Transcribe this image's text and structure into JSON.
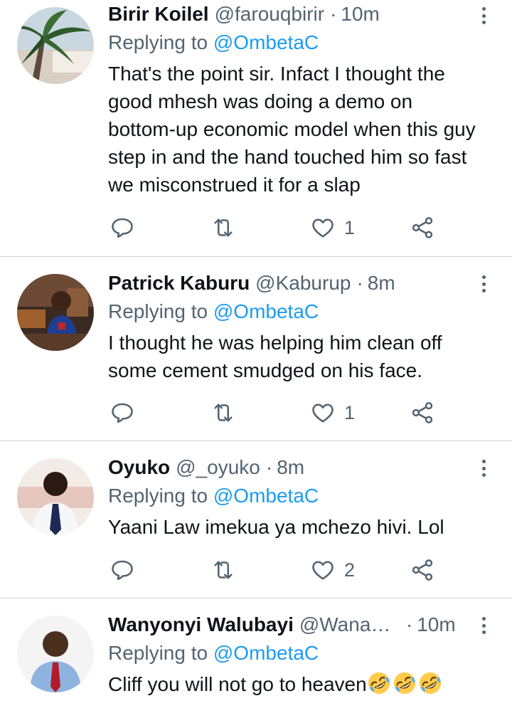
{
  "tweets": [
    {
      "name": "Birir Koilel",
      "handle": "@farouqbirir",
      "separator": "·",
      "time": "10m",
      "replying_prefix": "Replying to",
      "replying_to": "@OmbetaC",
      "text": "That's the point sir. Infact I thought the good mhesh was doing a demo on bottom-up economic model when this guy step in and the hand touched him so fast we misconstrued it for a slap",
      "likes": "1"
    },
    {
      "name": "Patrick Kaburu",
      "handle": "@Kaburup",
      "separator": "·",
      "time": "8m",
      "replying_prefix": "Replying to",
      "replying_to": "@OmbetaC",
      "text": "I thought he was helping him clean off some cement smudged on his face.",
      "likes": "1"
    },
    {
      "name": "Oyuko",
      "handle": "@_oyuko",
      "separator": "·",
      "time": "8m",
      "replying_prefix": "Replying to",
      "replying_to": "@OmbetaC",
      "text": "Yaani Law imekua ya mchezo hivi. Lol",
      "likes": "2"
    },
    {
      "name": "Wanyonyi Walubayi",
      "handle": "@Wananchi_ya_Kenya",
      "separator": "·",
      "time": "10m",
      "replying_prefix": "Replying to",
      "replying_to": "@OmbetaC",
      "text": "Cliff you will not go to heaven",
      "emojis": [
        "rolling-on-floor-laughing",
        "rolling-on-floor-laughing",
        "rolling-on-floor-laughing"
      ]
    }
  ],
  "colors": {
    "text": "#0f1419",
    "secondary": "#536471",
    "mention": "#1d9bf0",
    "divider": "#cfd9de"
  },
  "icons": [
    "reply-icon",
    "retweet-icon",
    "like-icon",
    "share-icon",
    "more-options-icon"
  ]
}
